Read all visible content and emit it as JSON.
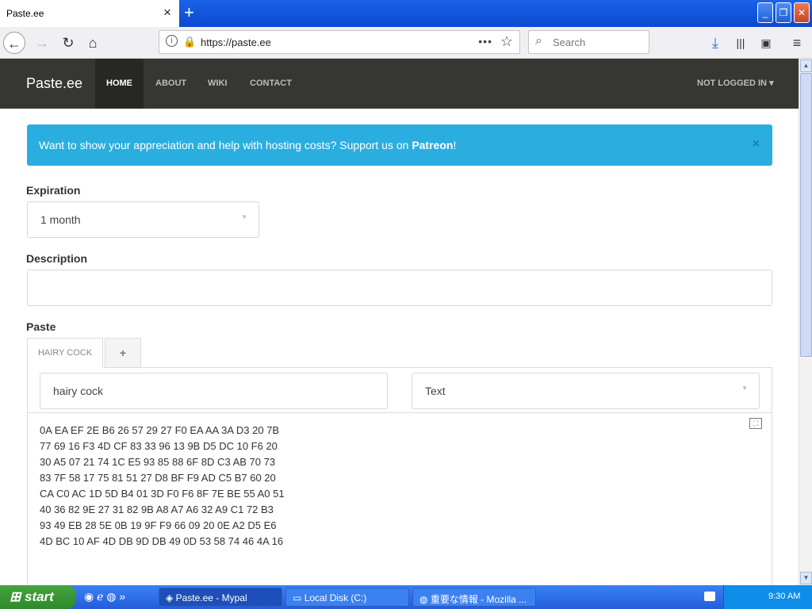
{
  "browser": {
    "tab_title": "Paste.ee",
    "tab_close": "×",
    "new_tab": "+",
    "url": "https://paste.ee",
    "search_placeholder": "Search"
  },
  "site": {
    "brand": "Paste.ee",
    "menu": [
      "HOME",
      "ABOUT",
      "WIKI",
      "CONTACT"
    ],
    "login": "NOT LOGGED IN"
  },
  "alert": {
    "text": "Want to show your appreciation and help with hosting costs? Support us on ",
    "link": "Patreon",
    "suffix": "!",
    "close": "×"
  },
  "form": {
    "expiration_label": "Expiration",
    "expiration_value": "1 month",
    "description_label": "Description",
    "description_value": "",
    "paste_label": "Paste",
    "paste_tab": "HAIRY COCK",
    "add_tab": "+",
    "paste_name": "hairy cock",
    "syntax": "Text",
    "content": "0A EA EF 2E B6 26 57 29 27 F0 EA AA 3A D3 20 7B\n77 69 16 F3 4D CF 83 33 96 13 9B D5 DC 10 F6 20\n30 A5 07 21 74 1C E5 93 85 88 6F 8D C3 AB 70 73\n83 7F 58 17 75 81 51 27 D8 BF F9 AD C5 B7 60 20\nCA C0 AC 1D 5D B4 01 3D F0 F6 8F 7E BE 55 A0 51\n40 36 82 9E 27 31 82 9B A8 A7 A6 32 A9 C1 72 B3\n93 49 EB 28 5E 0B 19 9F F9 66 09 20 0E A2 D5 E6\n4D BC 10 AF 4D DB 9D DB 49 0D 53 58 74 46 4A 16"
  },
  "taskbar": {
    "start": "start",
    "tasks": [
      "Paste.ee - Mypal",
      "Local Disk (C:)",
      "重要な情報 - Mozilla ..."
    ],
    "clock": "9:30 AM"
  }
}
